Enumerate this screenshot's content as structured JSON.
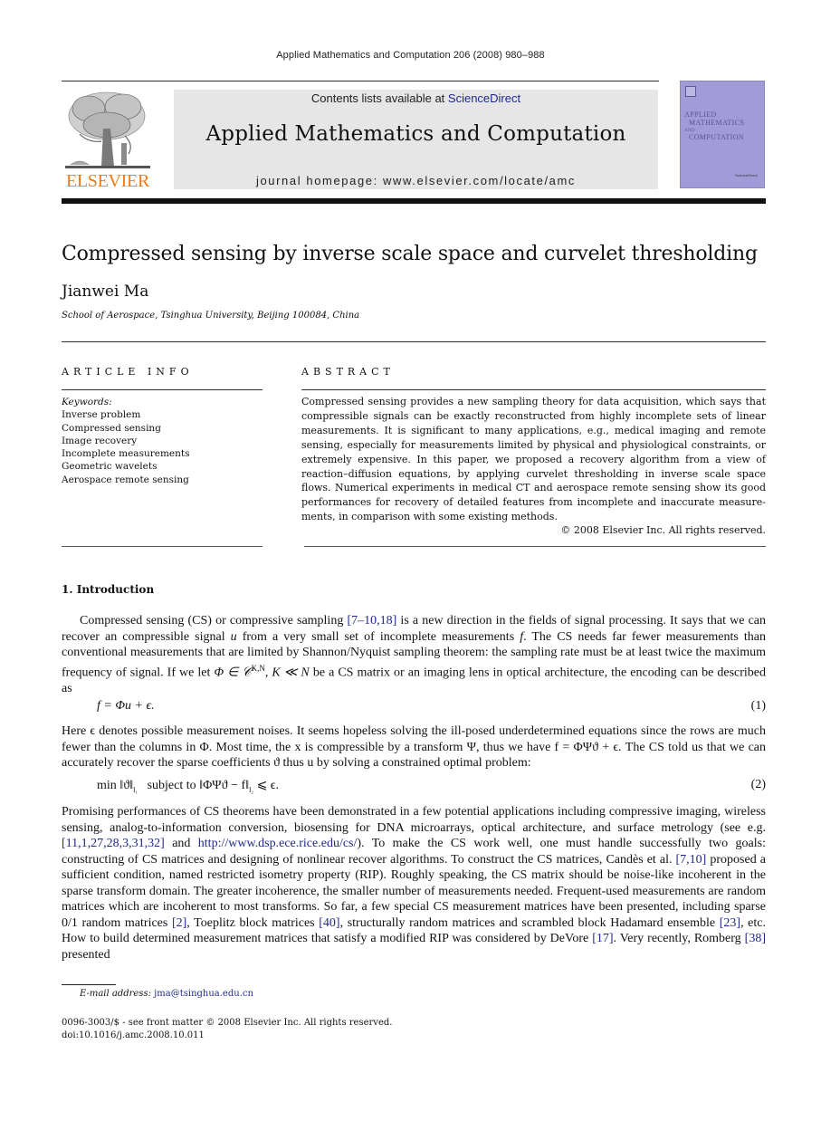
{
  "running_head": "Applied Mathematics and Computation 206 (2008) 980–988",
  "masthead": {
    "publisher_logo_text": "ELSEVIER",
    "contents_prefix": "Contents lists available at ",
    "contents_link": "ScienceDirect",
    "journal_title": "Applied Mathematics and Computation",
    "homepage": "journal homepage: www.elsevier.com/locate/amc",
    "cover": {
      "line1": "APPLIED",
      "line2": "MATHEMATICS",
      "line3": "AND",
      "line4": "COMPUTATION",
      "sd_label": "ScienceDirect",
      "color": "#a19cd7"
    },
    "logo_color": "#f07a1a",
    "link_color": "#1f2a8a"
  },
  "article": {
    "title": "Compressed sensing by inverse scale space and curvelet thresholding",
    "author": "Jianwei Ma",
    "affiliation": "School of Aerospace, Tsinghua University, Beijing 100084, China"
  },
  "article_info": {
    "heading": "ARTICLE INFO",
    "keywords_label": "Keywords:",
    "keywords": [
      "Inverse problem",
      "Compressed sensing",
      "Image recovery",
      "Incomplete measurements",
      "Geometric wavelets",
      "Aerospace remote sensing"
    ]
  },
  "abstract": {
    "heading": "ABSTRACT",
    "text": "Compressed sensing provides a new sampling theory for data acquisition, which says that compressible signals can be exactly reconstructed from highly incomplete sets of linear measurements. It is significant to many applications, e.g., medical imaging and remote sensing, especially for measurements limited by physical and physiological constraints, or extremely expensive. In this paper, we proposed a recovery algorithm from a view of reaction–diffusion equations, by applying curvelet thresholding in inverse scale space flows. Numerical experiments in medical CT and aerospace remote sensing show its good performances for recovery of detailed features from incomplete and inaccurate measure-ments, in comparison with some existing methods.",
    "copyright": "© 2008 Elsevier Inc. All rights reserved."
  },
  "intro": {
    "heading": "1. Introduction",
    "p1": {
      "a": "Compressed sensing (CS) or compressive sampling ",
      "ref1": "[7–10,18]",
      "b": " is a new direction in the fields of signal processing. It says that we can recover an compressible signal ",
      "u": "u",
      "c": " from a very small set of incomplete measurements ",
      "f": "f",
      "d": ". The CS needs far fewer measurements than conventional measurements that are limited by Shannon/Nyquist sampling theorem: the sampling rate must be at least twice the maximum frequency of signal. If we let ",
      "math": "Φ ∈ 𝒞",
      "sup": "K,N",
      "e": ", K ≪ N",
      "f2": " be a CS matrix or an imaging lens in optical architecture, the encoding can be described as"
    },
    "eq1": {
      "expr": "f = Φu + ϵ.",
      "num": "(1)"
    },
    "p2": "Here ϵ denotes possible measurement noises. It seems hopeless solving the ill-posed underdetermined equations since the rows are much fewer than the columns in Φ. Most time, the x is compressible by a transform Ψ, thus we have f = ΦΨϑ + ϵ. The CS told us that we can accurately recover the sparse coefficients ϑ thus u by solving a constrained optimal problem:",
    "eq2": {
      "expr_a": "min ‖ϑ‖",
      "sub_a": "l₁",
      "expr_b": "   subject to ‖ΦΨϑ − f‖",
      "sub_b": "l₂",
      "expr_c": " ⩽ ϵ.",
      "num": "(2)"
    },
    "p3": {
      "a": "Promising performances of CS theorems have been demonstrated in a few potential applications including compressive imaging, wireless sensing, analog-to-information conversion, biosensing for DNA microarrays, optical architecture, and surface metrology (see e.g. ",
      "ref_a": "[11,1,27,28,3,31,32]",
      "b": " and ",
      "url": "http://www.dsp.ece.rice.edu/cs/",
      "c": "). To make the CS work well, one must handle successfully two goals: constructing of CS matrices and designing of nonlinear recover algorithms. To construct the CS matrices, Candès et al. ",
      "ref_b": "[7,10]",
      "d": " proposed a sufficient condition, named restricted isometry property (RIP). Roughly speaking, the CS matrix should be noise-like incoherent in the sparse transform domain. The greater incoherence, the smaller number of measurements needed. Frequent-used measurements are random matrices which are incoherent to most transforms. So far, a few special CS measurement matrices have been presented, including sparse 0/1 random matrices ",
      "ref_c": "[2]",
      "e": ", Toeplitz block matrices ",
      "ref_d": "[40]",
      "f": ", structurally random matrices and scrambled block Hadamard ensemble ",
      "ref_e": "[23]",
      "g": ", etc. How to build determined measurement matrices that satisfy a modified RIP was considered by DeVore ",
      "ref_f": "[17]",
      "h": ". Very recently, Romberg ",
      "ref_g": "[38]",
      "i": " presented"
    }
  },
  "footnote": {
    "email_label": "E-mail address: ",
    "email": "jma@tsinghua.edu.cn",
    "front_matter": "0096-3003/$ - see front matter © 2008 Elsevier Inc. All rights reserved.",
    "doi": "doi:10.1016/j.amc.2008.10.011"
  }
}
